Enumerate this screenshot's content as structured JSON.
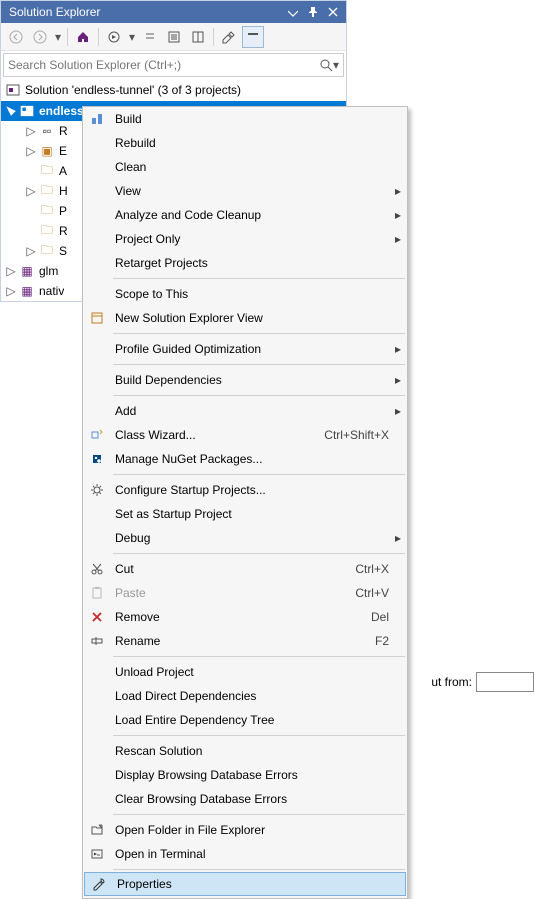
{
  "panel": {
    "title": "Solution Explorer"
  },
  "search": {
    "placeholder": "Search Solution Explorer (Ctrl+;)"
  },
  "solution_line": "Solution 'endless-tunnel' (3 of 3 projects)",
  "tree": {
    "selected": "endless-tunnel",
    "children": [
      {
        "label": "R"
      },
      {
        "label": "E"
      },
      {
        "label": "A"
      },
      {
        "label": "H"
      },
      {
        "label": "P"
      },
      {
        "label": "R"
      },
      {
        "label": "S"
      }
    ],
    "siblings": [
      {
        "label": "glm"
      },
      {
        "label": "nativ"
      }
    ]
  },
  "bg": {
    "label": "ut from:"
  },
  "menu": {
    "build": "Build",
    "rebuild": "Rebuild",
    "clean": "Clean",
    "view": "View",
    "analyze": "Analyze and Code Cleanup",
    "project_only": "Project Only",
    "retarget": "Retarget Projects",
    "scope": "Scope to This",
    "newview": "New Solution Explorer View",
    "pgo": "Profile Guided Optimization",
    "builddeps": "Build Dependencies",
    "add": "Add",
    "classwiz": "Class Wizard...",
    "classwiz_sc": "Ctrl+Shift+X",
    "nuget": "Manage NuGet Packages...",
    "cfgstartup": "Configure Startup Projects...",
    "setstartup": "Set as Startup Project",
    "debug": "Debug",
    "cut": "Cut",
    "cut_sc": "Ctrl+X",
    "paste": "Paste",
    "paste_sc": "Ctrl+V",
    "remove": "Remove",
    "remove_sc": "Del",
    "rename": "Rename",
    "rename_sc": "F2",
    "unload": "Unload Project",
    "loaddir": "Load Direct Dependencies",
    "loadtree": "Load Entire Dependency Tree",
    "rescan": "Rescan Solution",
    "disperr": "Display Browsing Database Errors",
    "clrerr": "Clear Browsing Database Errors",
    "openfolder": "Open Folder in File Explorer",
    "openterm": "Open in Terminal",
    "properties": "Properties"
  }
}
